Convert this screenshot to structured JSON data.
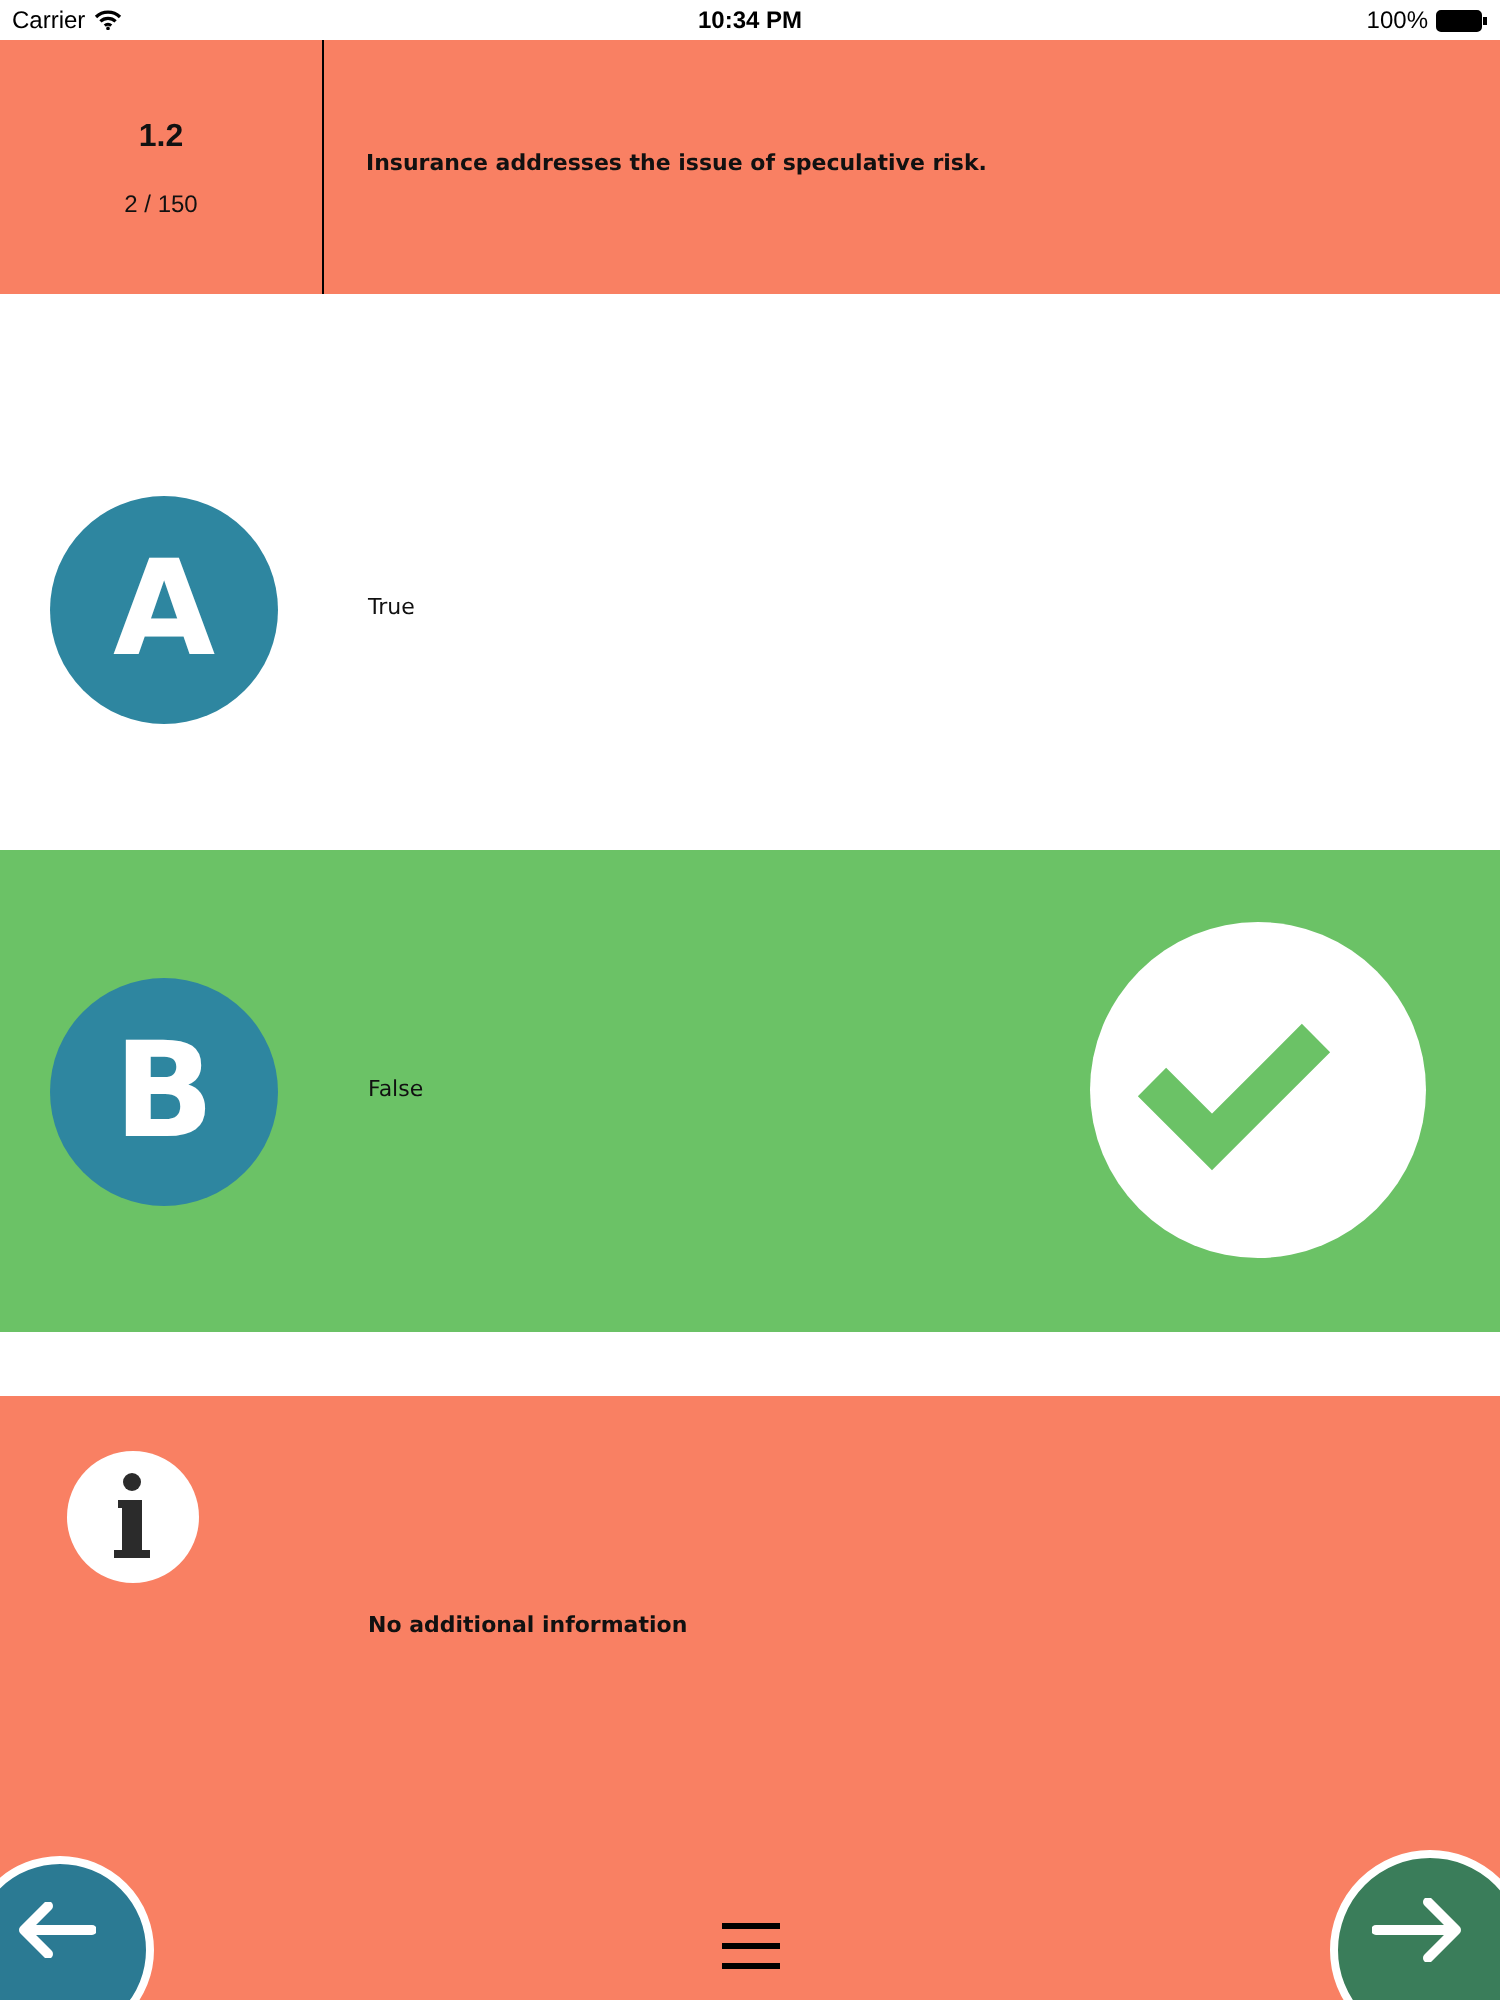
{
  "status_bar": {
    "carrier": "Carrier",
    "time": "10:34 PM",
    "battery": "100%"
  },
  "question": {
    "section": "1.2",
    "progress": "2 / 150",
    "text": "Insurance addresses the issue of speculative risk."
  },
  "answers": [
    {
      "letter": "A",
      "text": "True",
      "correct": false
    },
    {
      "letter": "B",
      "text": "False",
      "correct": true
    }
  ],
  "info": {
    "text": "No additional information"
  }
}
